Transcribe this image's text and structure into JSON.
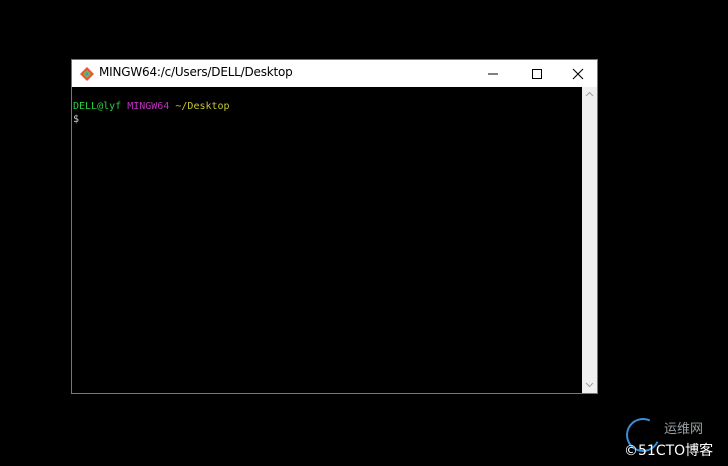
{
  "window": {
    "title": "MINGW64:/c/Users/DELL/Desktop",
    "icons": {
      "app": "git-diamond-icon",
      "minimize": "minimize-icon",
      "maximize": "maximize-icon",
      "close": "close-icon"
    }
  },
  "terminal": {
    "prompt_user": "DELL@lyf",
    "prompt_system": "MINGW64",
    "prompt_path": "~/Desktop",
    "cursor_symbol": "$",
    "colors": {
      "user": "#2ecc40",
      "system": "#c030c0",
      "path": "#c8c832",
      "text": "#d0d0d0"
    }
  },
  "scrollbar": {
    "up_icon": "chevron-up-icon",
    "down_icon": "chevron-down-icon"
  },
  "watermark": {
    "top_text": "运维网",
    "bottom_text": "©51CTO博客"
  }
}
